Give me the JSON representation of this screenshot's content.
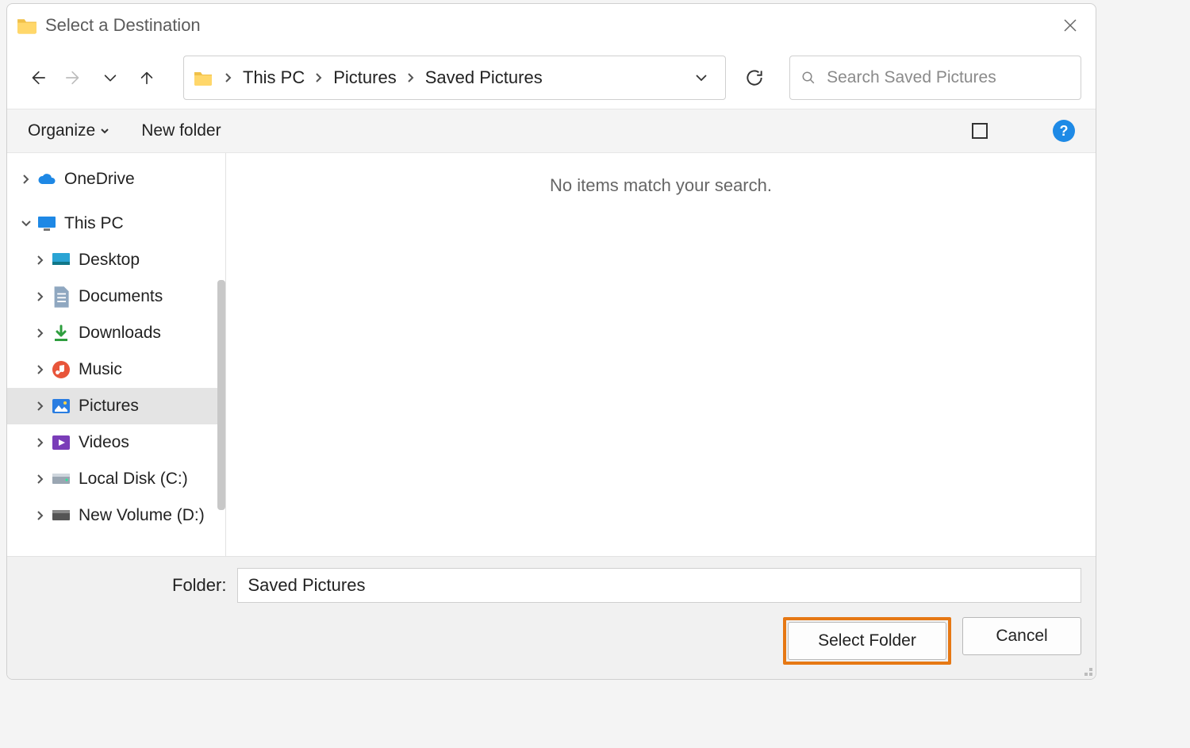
{
  "title": "Select a Destination",
  "breadcrumbs": {
    "0": "This PC",
    "1": "Pictures",
    "2": "Saved Pictures"
  },
  "search": {
    "placeholder": "Search Saved Pictures"
  },
  "toolbar": {
    "organize": "Organize",
    "new_folder": "New folder"
  },
  "tree": {
    "onedrive": "OneDrive",
    "thispc": "This PC",
    "desktop": "Desktop",
    "documents": "Documents",
    "downloads": "Downloads",
    "music": "Music",
    "pictures": "Pictures",
    "videos": "Videos",
    "localdisk": "Local Disk (C:)",
    "newvolume": "New Volume (D:)"
  },
  "content": {
    "empty": "No items match your search."
  },
  "footer": {
    "label": "Folder:",
    "value": "Saved Pictures",
    "select": "Select Folder",
    "cancel": "Cancel"
  },
  "help": "?"
}
